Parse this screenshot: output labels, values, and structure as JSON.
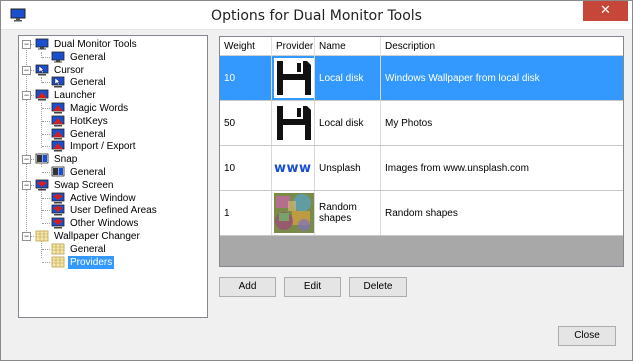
{
  "window": {
    "title": "Options for Dual Monitor Tools",
    "close_glyph": "✕"
  },
  "tree": [
    {
      "label": "Dual Monitor Tools",
      "icon": "monitor-icon",
      "level": 0,
      "expanded": true
    },
    {
      "label": "General",
      "icon": "monitor-small-icon",
      "level": 1
    },
    {
      "label": "Cursor",
      "icon": "cursor-monitor-icon",
      "level": 0,
      "expanded": true
    },
    {
      "label": "General",
      "icon": "cursor-monitor-icon",
      "level": 1
    },
    {
      "label": "Launcher",
      "icon": "launcher-icon",
      "level": 0,
      "expanded": true
    },
    {
      "label": "Magic Words",
      "icon": "launcher-icon",
      "level": 1
    },
    {
      "label": "HotKeys",
      "icon": "launcher-icon",
      "level": 1
    },
    {
      "label": "General",
      "icon": "launcher-icon",
      "level": 1
    },
    {
      "label": "Import / Export",
      "icon": "launcher-icon",
      "level": 1
    },
    {
      "label": "Snap",
      "icon": "snap-icon",
      "level": 0,
      "expanded": true
    },
    {
      "label": "General",
      "icon": "snap-icon",
      "level": 1
    },
    {
      "label": "Swap Screen",
      "icon": "swap-screen-icon",
      "level": 0,
      "expanded": true
    },
    {
      "label": "Active Window",
      "icon": "swap-screen-icon",
      "level": 1
    },
    {
      "label": "User Defined Areas",
      "icon": "swap-screen-icon",
      "level": 1
    },
    {
      "label": "Other Windows",
      "icon": "swap-screen-icon",
      "level": 1
    },
    {
      "label": "Wallpaper Changer",
      "icon": "wallpaper-icon",
      "level": 0,
      "expanded": true
    },
    {
      "label": "General",
      "icon": "wallpaper-icon",
      "level": 1
    },
    {
      "label": "Providers",
      "icon": "wallpaper-icon",
      "level": 1,
      "selected": true
    }
  ],
  "grid": {
    "columns": [
      "Weight",
      "Provider",
      "Name",
      "Description"
    ],
    "rows": [
      {
        "weight": "10",
        "provider_icon": "floppy-disk-icon",
        "name": "Local disk",
        "description": "Windows Wallpaper from local disk",
        "selected": true
      },
      {
        "weight": "50",
        "provider_icon": "floppy-disk-icon",
        "name": "Local disk",
        "description": "My Photos"
      },
      {
        "weight": "10",
        "provider_icon": "www-icon",
        "provider_text": "www",
        "name": "Unsplash",
        "description": "Images from www.unsplash.com"
      },
      {
        "weight": "1",
        "provider_icon": "random-shapes-icon",
        "name": "Random shapes",
        "description": "Random shapes"
      }
    ]
  },
  "buttons": {
    "add": "Add",
    "edit": "Edit",
    "delete": "Delete",
    "close": "Close"
  },
  "colors": {
    "selection": "#3399ff",
    "close_button": "#c7463a"
  }
}
